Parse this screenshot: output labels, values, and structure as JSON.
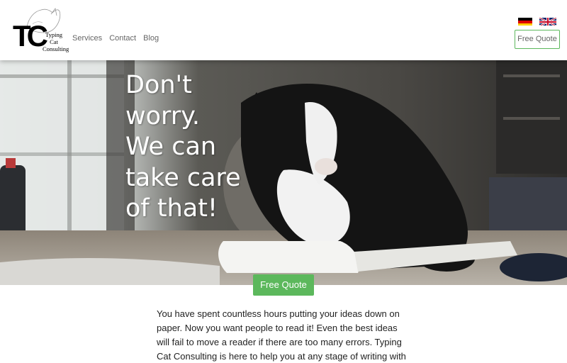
{
  "header": {
    "logo": {
      "initials": "TC",
      "subtitle": "Typing Cat Consulting"
    },
    "nav": [
      {
        "label": "Services"
      },
      {
        "label": "Contact"
      },
      {
        "label": "Blog"
      }
    ],
    "languages": [
      {
        "icon": "german-flag-icon"
      },
      {
        "icon": "uk-flag-icon"
      }
    ],
    "quote_button": "Free Quote"
  },
  "hero": {
    "headline": "Don't worry. We can take care of that!",
    "quote_button": "Free Quote"
  },
  "intro": {
    "text": "You have spent countless hours putting your ideas down on paper. Now you want people to read it! Even the best ideas will fail to move a reader if there are too many errors. Typing Cat Consulting is here to help you at any stage of writing with"
  },
  "colors": {
    "accent": "#5cb85c",
    "nav_text": "#666666"
  }
}
